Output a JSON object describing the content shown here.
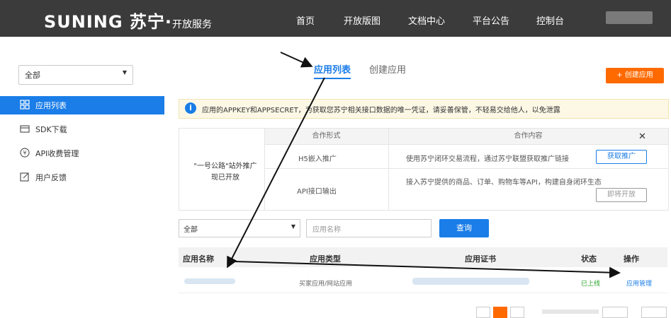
{
  "header": {
    "logo_brand": "SUNING 苏宁·",
    "logo_sub": "开放服务",
    "nav": [
      "首页",
      "开放版图",
      "文档中心",
      "平台公告",
      "控制台"
    ]
  },
  "sidebar": {
    "filter_value": "全部",
    "items": [
      {
        "label": "应用列表",
        "icon": "grid-icon",
        "active": true
      },
      {
        "label": "SDK下载",
        "icon": "box-icon"
      },
      {
        "label": "API收费管理",
        "icon": "yen-icon"
      },
      {
        "label": "用户反馈",
        "icon": "edit-icon"
      }
    ]
  },
  "tabs": [
    {
      "label": "应用列表",
      "active": true
    },
    {
      "label": "创建应用"
    }
  ],
  "create_button": "+ 创建应用",
  "notice": "应用的APPKEY和APPSECRET，为获取您苏宁相关接口数据的唯一凭证，请妥善保管，不轻易交给他人，以免泄露",
  "promo": {
    "intro_line1": "\"一号公路\"站外推广",
    "intro_line2": "现已开放",
    "header_form": "合作形式",
    "header_content": "合作内容",
    "close": "✕",
    "rows": [
      {
        "form": "H5嵌入推广",
        "content": "使用苏宁闭环交易流程，通过苏宁联盟获取推广链接",
        "button": "获取推广"
      },
      {
        "form": "API接口输出",
        "content": "接入苏宁提供的商品、订单、购物车等API，构建自身闭环生态",
        "button": "即将开放"
      }
    ]
  },
  "filter": {
    "type_value": "全部",
    "name_placeholder": "应用名称",
    "query_button": "查询"
  },
  "table": {
    "headers": [
      "应用名称",
      "应用类型",
      "应用证书",
      "状态",
      "操作"
    ],
    "rows": [
      {
        "type": "买家应用/网站应用",
        "status": "已上线",
        "action": "应用管理"
      }
    ]
  },
  "colors": {
    "accent": "#1a7de8",
    "orange": "#ff6a00",
    "topbar": "#3b3b3b",
    "online": "#2aa52a"
  }
}
